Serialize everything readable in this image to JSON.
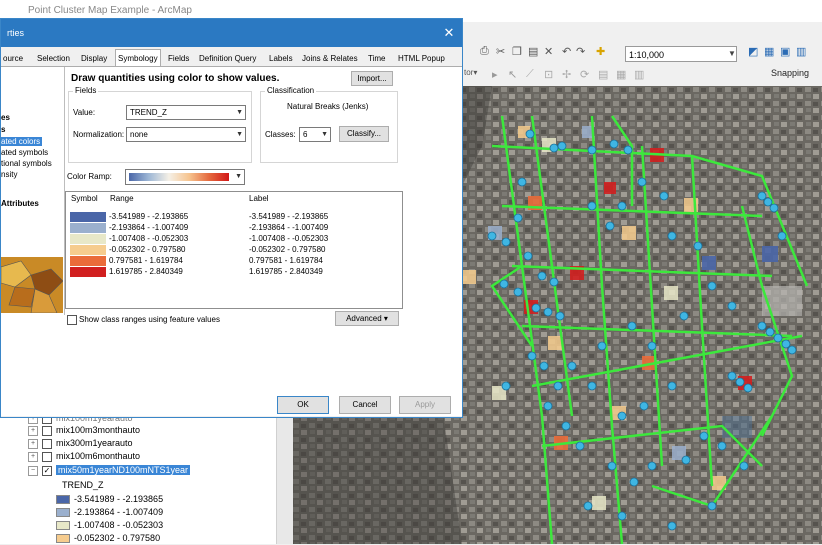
{
  "app": {
    "title": "Point Cluster Map Example - ArcMap"
  },
  "toolbar": {
    "scale": "1:10,000",
    "snapping_label": "Snapping"
  },
  "dialog": {
    "title": "rties",
    "tabs": [
      "ource",
      "Selection",
      "Display",
      "Symbology",
      "Fields",
      "Definition Query",
      "Labels",
      "Joins & Relates",
      "Time",
      "HTML Popup"
    ],
    "active_tab": "Symbology",
    "show_list": [
      "es",
      "s",
      "ated colors",
      "ated symbols",
      "tional symbols",
      "nsity",
      "Attributes"
    ],
    "heading": "Draw quantities using color to show values.",
    "import_label": "Import...",
    "fields_group_label": "Fields",
    "value_label": "Value:",
    "value": "TREND_Z",
    "normalization_label": "Normalization:",
    "normalization": "none",
    "classification_group_label": "Classification",
    "classification_method": "Natural Breaks (Jenks)",
    "classes_label": "Classes:",
    "classes_value": "6",
    "classify_label": "Classify...",
    "color_ramp_label": "Color Ramp:",
    "table_headers": {
      "symbol": "Symbol",
      "range": "Range",
      "label": "Label"
    },
    "classes": [
      {
        "range": "-3.541989 - -2.193865",
        "label": "-3.541989 - -2.193865",
        "color": "#4a66a8"
      },
      {
        "range": "-2.193864 - -1.007409",
        "label": "-2.193864 - -1.007409",
        "color": "#9bb0ce"
      },
      {
        "range": "-1.007408 - -0.052303",
        "label": "-1.007408 - -0.052303",
        "color": "#e8e8c8"
      },
      {
        "range": "-0.052302 - 0.797580",
        "label": "-0.052302 - 0.797580",
        "color": "#f6cc8e"
      },
      {
        "range": "0.797581 - 1.619784",
        "label": "0.797581 - 1.619784",
        "color": "#ea6b3a"
      },
      {
        "range": "1.619785 - 2.840349",
        "label": "1.619785 - 2.840349",
        "color": "#d11f1f"
      }
    ],
    "show_ranges_label": "Show class ranges using feature values",
    "advanced_label": "Advanced",
    "ok_label": "OK",
    "cancel_label": "Cancel",
    "apply_label": "Apply"
  },
  "toc": {
    "partial_layer": "mix100m1yearauto",
    "layers": [
      {
        "name": "mix100m3monthauto",
        "checked": false
      },
      {
        "name": "mix300m1yearauto",
        "checked": false
      },
      {
        "name": "mix100m6monthauto",
        "checked": false
      },
      {
        "name": "mix50m1yearND100mNTS1year",
        "checked": true
      }
    ],
    "field": "TREND_Z",
    "legend": [
      {
        "label": "-3.541989 - -2.193865",
        "color": "#4a66a8"
      },
      {
        "label": "-2.193864 - -1.007409",
        "color": "#9bb0ce"
      },
      {
        "label": "-1.007408 - -0.052303",
        "color": "#e8e8c8"
      },
      {
        "label": "-0.052302 - 0.797580",
        "color": "#f6cc8e"
      }
    ]
  }
}
